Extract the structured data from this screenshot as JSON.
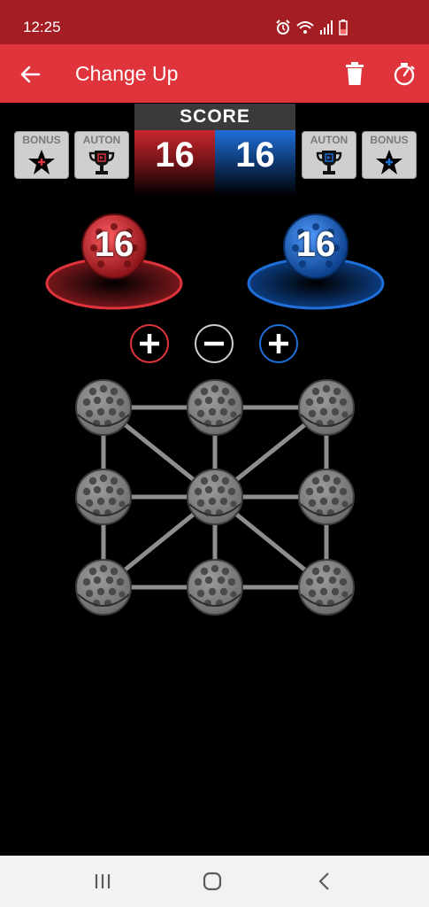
{
  "status": {
    "time": "12:25"
  },
  "appbar": {
    "title": "Change Up"
  },
  "tiles": {
    "left_bonus": "BONUS",
    "left_auton": "AUTON",
    "right_auton": "AUTON",
    "right_bonus": "BONUS"
  },
  "score": {
    "header": "SCORE",
    "red": "16",
    "blue": "16"
  },
  "goals": {
    "red_count": "16",
    "blue_count": "16"
  },
  "colors": {
    "red": "#e0343c",
    "blue": "#1e6fd9",
    "status": "#a31d22"
  },
  "icons": [
    "back-arrow-icon",
    "trash-icon",
    "timer-icon",
    "star-icon",
    "trophy-icon",
    "plus-icon",
    "minus-icon",
    "menu-icon",
    "home-icon",
    "back-chevron-icon"
  ]
}
